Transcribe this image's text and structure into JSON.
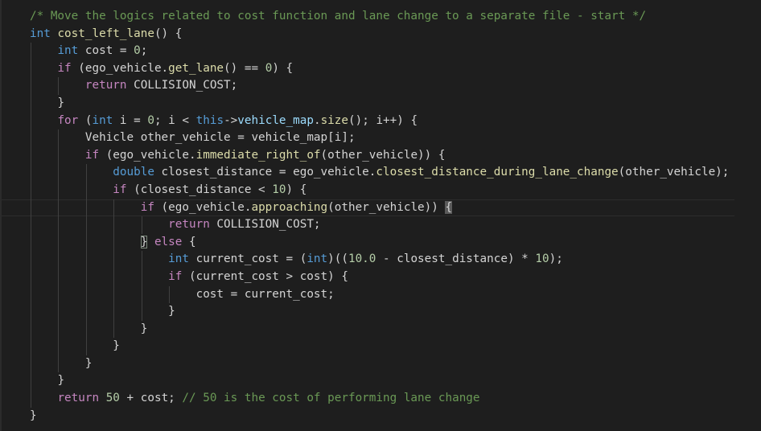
{
  "editor": {
    "theme_colors": {
      "background": "#1e1e1e",
      "text": "#d4d4d4",
      "keyword": "#569cd6",
      "control": "#c586c0",
      "function": "#dcdcaa",
      "number": "#b5cea8",
      "comment": "#6a9955",
      "member": "#9cdcfe"
    },
    "current_line": 11,
    "lines": [
      {
        "indent": 0,
        "tokens": [
          [
            "c",
            "/* Move the logics related to cost function and lane change to a separate file - start */"
          ]
        ]
      },
      {
        "indent": 0,
        "tokens": [
          [
            "k",
            "int"
          ],
          [
            "t",
            " "
          ],
          [
            "f",
            "cost_left_lane"
          ],
          [
            "t",
            "() {"
          ]
        ]
      },
      {
        "indent": 4,
        "tokens": [
          [
            "k",
            "int"
          ],
          [
            "t",
            " cost = "
          ],
          [
            "n",
            "0"
          ],
          [
            "t",
            ";"
          ]
        ]
      },
      {
        "indent": 4,
        "tokens": [
          [
            "p",
            "if"
          ],
          [
            "t",
            " (ego_vehicle."
          ],
          [
            "f",
            "get_lane"
          ],
          [
            "t",
            "() == "
          ],
          [
            "n",
            "0"
          ],
          [
            "t",
            ") {"
          ]
        ]
      },
      {
        "indent": 8,
        "tokens": [
          [
            "p",
            "return"
          ],
          [
            "t",
            " COLLISION_COST;"
          ]
        ]
      },
      {
        "indent": 4,
        "tokens": [
          [
            "t",
            "}"
          ]
        ]
      },
      {
        "indent": 4,
        "tokens": [
          [
            "p",
            "for"
          ],
          [
            "t",
            " ("
          ],
          [
            "k",
            "int"
          ],
          [
            "t",
            " i = "
          ],
          [
            "n",
            "0"
          ],
          [
            "t",
            "; i < "
          ],
          [
            "k",
            "this"
          ],
          [
            "t",
            "->"
          ],
          [
            "m",
            "vehicle_map"
          ],
          [
            "t",
            "."
          ],
          [
            "f",
            "size"
          ],
          [
            "t",
            "(); i++) {"
          ]
        ]
      },
      {
        "indent": 8,
        "tokens": [
          [
            "t",
            "Vehicle other_vehicle = vehicle_map[i];"
          ]
        ]
      },
      {
        "indent": 8,
        "tokens": [
          [
            "p",
            "if"
          ],
          [
            "t",
            " (ego_vehicle."
          ],
          [
            "f",
            "immediate_right_of"
          ],
          [
            "t",
            "(other_vehicle)) {"
          ]
        ]
      },
      {
        "indent": 12,
        "tokens": [
          [
            "k",
            "double"
          ],
          [
            "t",
            " closest_distance = ego_vehicle."
          ],
          [
            "f",
            "closest_distance_during_lane_change"
          ],
          [
            "t",
            "(other_vehicle);"
          ]
        ]
      },
      {
        "indent": 12,
        "tokens": [
          [
            "p",
            "if"
          ],
          [
            "t",
            " (closest_distance < "
          ],
          [
            "n",
            "10"
          ],
          [
            "t",
            ") {"
          ]
        ]
      },
      {
        "indent": 16,
        "tokens": [
          [
            "p",
            "if"
          ],
          [
            "t",
            " (ego_vehicle."
          ],
          [
            "f",
            "approaching"
          ],
          [
            "t",
            "(other_vehicle)) "
          ],
          [
            "t bm",
            "{"
          ]
        ]
      },
      {
        "indent": 20,
        "tokens": [
          [
            "p",
            "return"
          ],
          [
            "t",
            " COLLISION_COST;"
          ]
        ]
      },
      {
        "indent": 16,
        "tokens": [
          [
            "t bo",
            "}"
          ],
          [
            "t",
            " "
          ],
          [
            "p",
            "else"
          ],
          [
            "t",
            " {"
          ]
        ]
      },
      {
        "indent": 20,
        "tokens": [
          [
            "k",
            "int"
          ],
          [
            "t",
            " current_cost = ("
          ],
          [
            "k",
            "int"
          ],
          [
            "t",
            ")(("
          ],
          [
            "n",
            "10.0"
          ],
          [
            "t",
            " - closest_distance) * "
          ],
          [
            "n",
            "10"
          ],
          [
            "t",
            ");"
          ]
        ]
      },
      {
        "indent": 20,
        "tokens": [
          [
            "p",
            "if"
          ],
          [
            "t",
            " (current_cost > cost) {"
          ]
        ]
      },
      {
        "indent": 24,
        "tokens": [
          [
            "t",
            "cost = current_cost;"
          ]
        ]
      },
      {
        "indent": 20,
        "tokens": [
          [
            "t",
            "}"
          ]
        ]
      },
      {
        "indent": 16,
        "tokens": [
          [
            "t",
            "}"
          ]
        ]
      },
      {
        "indent": 12,
        "tokens": [
          [
            "t",
            "}"
          ]
        ]
      },
      {
        "indent": 8,
        "tokens": [
          [
            "t",
            "}"
          ]
        ]
      },
      {
        "indent": 4,
        "tokens": [
          [
            "t",
            "}"
          ]
        ]
      },
      {
        "indent": 4,
        "tokens": [
          [
            "p",
            "return"
          ],
          [
            "t",
            " "
          ],
          [
            "n",
            "50"
          ],
          [
            "t",
            " + cost; "
          ],
          [
            "c",
            "// 50 is the cost of performing lane change"
          ]
        ]
      },
      {
        "indent": 0,
        "tokens": [
          [
            "t",
            "}"
          ]
        ]
      }
    ]
  }
}
